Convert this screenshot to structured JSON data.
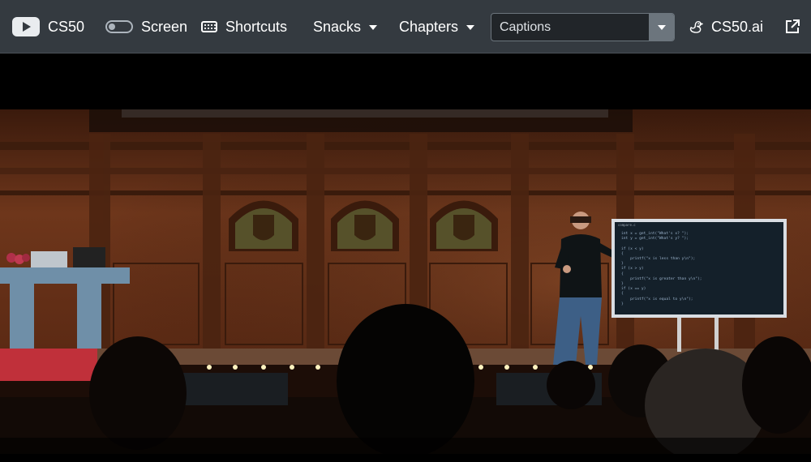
{
  "toolbar": {
    "course_title": "CS50",
    "screen_label": "Screen",
    "shortcuts_label": "Shortcuts",
    "snacks_label": "Snacks",
    "chapters_label": "Chapters",
    "captions_value": "Captions",
    "ai_label": "CS50.ai",
    "screen_toggle_state": "off"
  },
  "video": {
    "screen_lines": [
      "int x = get_int(\"What's x? \");",
      "int y = get_int(\"What's y? \");",
      "",
      "if (x < y)",
      "{",
      "    printf(\"x is less than y\\n\");",
      "}",
      "if (x > y)",
      "{",
      "    printf(\"x is greater than y\\n\");",
      "}",
      "if (x == y)",
      "{",
      "    printf(\"x is equal to y\\n\");",
      "}"
    ],
    "screen_tab": "compare.c"
  },
  "colors": {
    "toolbar_bg": "#343a40",
    "select_bg": "#212529",
    "select_button": "#6c757d",
    "wood": "#6b331a"
  }
}
